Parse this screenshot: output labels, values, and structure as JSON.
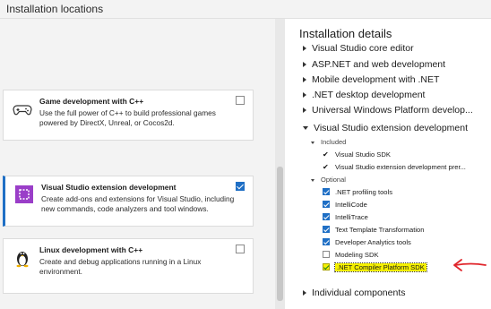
{
  "topbar": {
    "title": "Installation locations"
  },
  "cards": [
    {
      "title": "Game development with C++",
      "description": "Use the full power of C++ to build professional games powered by DirectX, Unreal, or Cocos2d.",
      "checked": false
    },
    {
      "title": "Visual Studio extension development",
      "description": "Create add-ons and extensions for Visual Studio, including new commands, code analyzers and tool windows.",
      "checked": true
    },
    {
      "title": "Linux development with C++",
      "description": "Create and debug applications running in a Linux environment.",
      "checked": false
    }
  ],
  "details": {
    "title": "Installation details",
    "workloads": [
      "Visual Studio core editor",
      "ASP.NET and web development",
      "Mobile development with .NET",
      ".NET desktop development",
      "Universal Windows Platform develop..."
    ],
    "expanded_workload": "Visual Studio extension development",
    "included_label": "Included",
    "included_items": [
      "Visual Studio SDK",
      "Visual Studio extension development prer..."
    ],
    "optional_label": "Optional",
    "optional_items": [
      {
        "label": ".NET profiling tools",
        "checked": true
      },
      {
        "label": "IntelliCode",
        "checked": true
      },
      {
        "label": "IntelliTrace",
        "checked": true
      },
      {
        "label": "Text Template Transformation",
        "checked": true
      },
      {
        "label": "Developer Analytics tools",
        "checked": true
      },
      {
        "label": "Modeling SDK",
        "checked": false
      },
      {
        "label": ".NET Compiler Platform SDK",
        "checked": true,
        "highlighted": true
      }
    ],
    "last_workload": "Individual components"
  },
  "colors": {
    "accent": "#1f6fc5",
    "highlight": "#f5f000",
    "annotation_arrow": "#e0242a"
  }
}
